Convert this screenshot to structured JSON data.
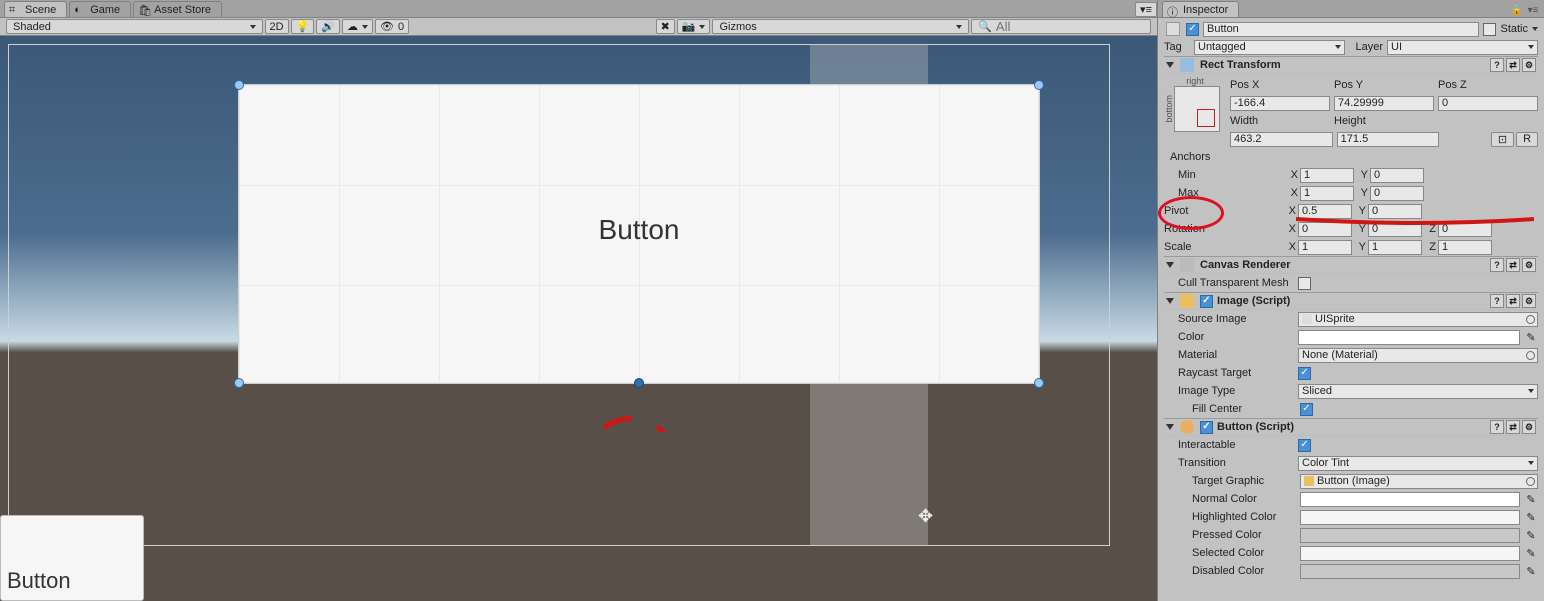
{
  "tabs": {
    "scene": "Scene",
    "game": "Game",
    "asset_store": "Asset Store"
  },
  "scene_toolbar": {
    "shading": "Shaded",
    "dim2d": "2D",
    "gizmos": "Gizmos",
    "search_placeholder": "All",
    "zero": "0"
  },
  "scene": {
    "big_button_label": "Button",
    "preview_label": "Button"
  },
  "inspector": {
    "tab": "Inspector",
    "name": "Button",
    "static": "Static",
    "tag_label": "Tag",
    "tag_value": "Untagged",
    "layer_label": "Layer",
    "layer_value": "UI",
    "rect_transform": {
      "title": "Rect Transform",
      "anchor_h": "right",
      "anchor_v": "bottom",
      "posx_lbl": "Pos X",
      "posy_lbl": "Pos Y",
      "posz_lbl": "Pos Z",
      "posx": "-166.4",
      "posy": "74.29999",
      "posz": "0",
      "w_lbl": "Width",
      "h_lbl": "Height",
      "w": "463.2",
      "h": "171.5",
      "rbtn": "R",
      "anchors": "Anchors",
      "min": "Min",
      "min_x": "1",
      "min_y": "0",
      "max": "Max",
      "max_x": "1",
      "max_y": "0",
      "pivot": "Pivot",
      "pivot_x": "0.5",
      "pivot_y": "0",
      "rotation": "Rotation",
      "rot_x": "0",
      "rot_y": "0",
      "rot_z": "0",
      "scale": "Scale",
      "sc_x": "1",
      "sc_y": "1",
      "sc_z": "1"
    },
    "canvas_renderer": {
      "title": "Canvas Renderer",
      "cull": "Cull Transparent Mesh"
    },
    "image": {
      "title": "Image (Script)",
      "source": "Source Image",
      "source_val": "UISprite",
      "color": "Color",
      "material": "Material",
      "material_val": "None (Material)",
      "raycast": "Raycast Target",
      "type": "Image Type",
      "type_val": "Sliced",
      "fill": "Fill Center"
    },
    "button": {
      "title": "Button (Script)",
      "interactable": "Interactable",
      "transition": "Transition",
      "transition_val": "Color Tint",
      "target": "Target Graphic",
      "target_val": "Button (Image)",
      "normal": "Normal Color",
      "highlighted": "Highlighted Color",
      "pressed": "Pressed Color",
      "selected": "Selected Color",
      "disabled": "Disabled Color"
    }
  }
}
